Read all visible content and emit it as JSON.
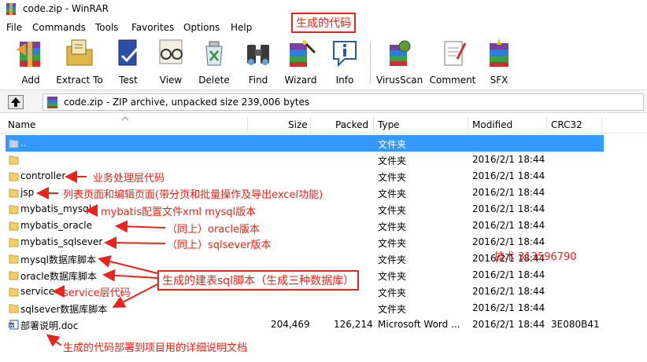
{
  "window": {
    "title": "code.zip - WinRAR"
  },
  "menu": [
    "File",
    "Commands",
    "Tools",
    "Favorites",
    "Options",
    "Help"
  ],
  "toolbar": {
    "add": "Add",
    "extract": "Extract To",
    "test": "Test",
    "view": "View",
    "delete": "Delete",
    "find": "Find",
    "wizard": "Wizard",
    "info": "Info",
    "virusscan": "VirusScan",
    "comment": "Comment",
    "sfx": "SFX"
  },
  "address": {
    "text": "code.zip - ZIP archive, unpacked size 239,006 bytes"
  },
  "columns": {
    "name": "Name",
    "size": "Size",
    "packed": "Packed",
    "type": "Type",
    "modified": "Modified",
    "crc": "CRC32"
  },
  "files": [
    {
      "name": "..",
      "size": "",
      "packed": "",
      "type": "文件夹",
      "modified": "",
      "crc": ""
    },
    {
      "name": "",
      "size": "",
      "packed": "",
      "type": "文件夹",
      "modified": "2016/2/1 18:44",
      "crc": ""
    },
    {
      "name": "controller",
      "size": "",
      "packed": "",
      "type": "文件夹",
      "modified": "2016/2/1 18:44",
      "crc": ""
    },
    {
      "name": "jsp",
      "size": "",
      "packed": "",
      "type": "文件夹",
      "modified": "2016/2/1 18:44",
      "crc": ""
    },
    {
      "name": "mybatis_mysql",
      "size": "",
      "packed": "",
      "type": "文件夹",
      "modified": "2016/2/1 18:44",
      "crc": ""
    },
    {
      "name": "mybatis_oracle",
      "size": "",
      "packed": "",
      "type": "文件夹",
      "modified": "2016/2/1 18:44",
      "crc": ""
    },
    {
      "name": "mybatis_sqlsever",
      "size": "",
      "packed": "",
      "type": "文件夹",
      "modified": "2016/2/1 18:44",
      "crc": ""
    },
    {
      "name": "mysql数据库脚本",
      "size": "",
      "packed": "",
      "type": "文件夹",
      "modified": "2016/2/1 18:44",
      "crc": ""
    },
    {
      "name": "oracle数据库脚本",
      "size": "",
      "packed": "",
      "type": "文件夹",
      "modified": "2016/2/1 18:44",
      "crc": ""
    },
    {
      "name": "service",
      "size": "",
      "packed": "",
      "type": "文件夹",
      "modified": "2016/2/1 18:44",
      "crc": ""
    },
    {
      "name": "sqlsever数据库脚本",
      "size": "",
      "packed": "",
      "type": "文件夹",
      "modified": "2016/2/1 18:44",
      "crc": ""
    },
    {
      "name": "部署说明.doc",
      "size": "204,469",
      "packed": "126,214",
      "type": "Microsoft Word ...",
      "modified": "2016/2/1 18:44",
      "crc": "3E080B41"
    }
  ],
  "annotations": {
    "generated_code": "生成的代码",
    "controller": "业务处理层代码",
    "jsp": "列表页面和编辑页面(带分页和批量操作及导出excel功能)",
    "mysql": "mybatis配置文件xml  mysql版本",
    "oracle": "（同上）oracle版本",
    "sqlsever": "（同上）sqlsever版本",
    "tech": "技术  313596790",
    "sql_scripts": "生成的建表sql脚本（生成三种数据库）",
    "service": "service层代码",
    "doc": "生成的代码部署到项目用的详细说明文档"
  },
  "colors": {
    "selection": "#3399ff",
    "annotation": "#e8241c"
  }
}
